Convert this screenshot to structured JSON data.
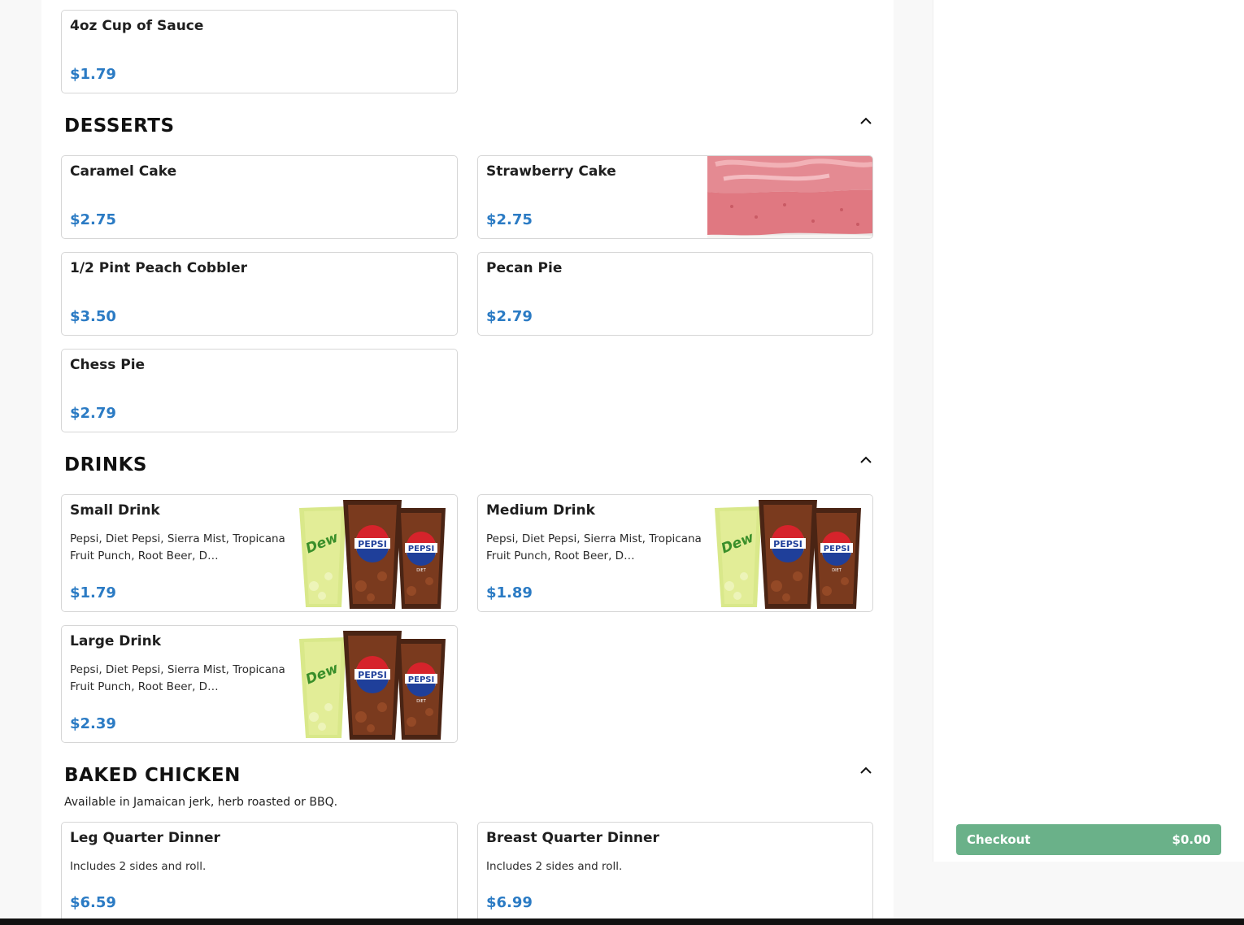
{
  "sauce": {
    "name": "4oz Cup of Sauce",
    "price": "$1.79"
  },
  "desserts": {
    "title": "DESSERTS",
    "items": [
      {
        "name": "Caramel Cake",
        "price": "$2.75"
      },
      {
        "name": "Strawberry Cake",
        "price": "$2.75"
      },
      {
        "name": "1/2 Pint Peach Cobbler",
        "price": "$3.50"
      },
      {
        "name": "Pecan Pie",
        "price": "$2.79"
      },
      {
        "name": "Chess Pie",
        "price": "$2.79"
      }
    ]
  },
  "drinks": {
    "title": "DRINKS",
    "items": [
      {
        "name": "Small Drink",
        "desc": "Pepsi, Diet Pepsi, Sierra Mist, Tropicana Fruit Punch, Root Beer, D…",
        "price": "$1.79"
      },
      {
        "name": "Medium Drink",
        "desc": "Pepsi, Diet Pepsi, Sierra Mist, Tropicana Fruit Punch, Root Beer, D…",
        "price": "$1.89"
      },
      {
        "name": "Large Drink",
        "desc": "Pepsi, Diet Pepsi, Sierra Mist, Tropicana Fruit Punch, Root Beer, D…",
        "price": "$2.39"
      }
    ],
    "cup_labels": {
      "dew": "Mtn Dew",
      "pepsi": "PEPSI",
      "diet": "DIET"
    }
  },
  "baked_chicken": {
    "title": "BAKED CHICKEN",
    "subtitle": "Available in Jamaican jerk, herb roasted or BBQ.",
    "items": [
      {
        "name": "Leg Quarter Dinner",
        "desc": "Includes 2 sides and roll.",
        "price": "$6.59"
      },
      {
        "name": "Breast Quarter Dinner",
        "desc": "Includes 2 sides and roll.",
        "price": "$6.99"
      }
    ]
  },
  "checkout": {
    "label": "Checkout",
    "total": "$0.00"
  },
  "icons": {
    "section_toggle": "chevron-up-icon"
  },
  "colors": {
    "price": "#2b7bc4",
    "checkout": "#6ab189"
  }
}
